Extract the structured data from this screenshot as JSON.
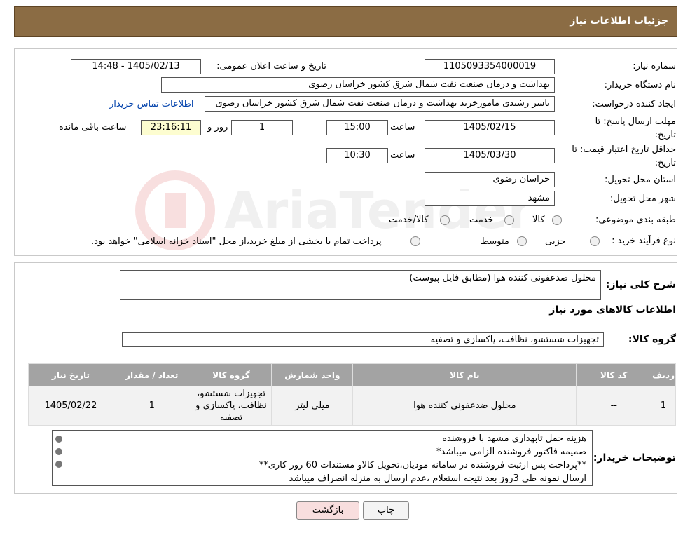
{
  "header": {
    "title": "جزئیات اطلاعات نیاز"
  },
  "fields": {
    "need_number_label": "شماره نیاز:",
    "need_number": "1105093354000019",
    "announce_label": "تاریخ و ساعت اعلان عمومی:",
    "announce_value": "1405/02/13 - 14:48",
    "buyer_org_label": "نام دستگاه خریدار:",
    "buyer_org": "بهداشت و درمان صنعت نفت شمال شرق کشور   خراسان رضوی",
    "creator_label": "ایجاد کننده درخواست:",
    "creator": "یاسر رشیدی مامورخرید بهداشت و درمان صنعت نفت شمال شرق کشور   خراسان رضوی",
    "contact_link": "اطلاعات تماس خریدار",
    "deadline_label_1": "مهلت ارسال پاسخ: تا",
    "deadline_label_2": "تاریخ:",
    "deadline_date": "1405/02/15",
    "time_label": "ساعت",
    "deadline_time": "15:00",
    "days_count": "1",
    "days_label": "روز و",
    "remaining_time": "23:16:11",
    "remaining_label": "ساعت باقی مانده",
    "validity_label_1": "حداقل تاریخ اعتبار قیمت: تا",
    "validity_label_2": "تاریخ:",
    "validity_date": "1405/03/30",
    "validity_time": "10:30",
    "province_label": "استان محل تحویل:",
    "province": "خراسان رضوی",
    "city_label": "شهر محل تحویل:",
    "city": "مشهد",
    "category_label": "طبقه بندی موضوعی:",
    "category_options": [
      "کالا",
      "خدمت",
      "کالا/خدمت"
    ],
    "process_label": "نوع فرآیند خرید :",
    "process_options": [
      "جزیی",
      "متوسط"
    ],
    "process_note": "پرداخت تمام یا بخشی از مبلغ خرید،از محل \"اسناد خزانه اسلامی\" خواهد بود."
  },
  "summary": {
    "desc_label": "شرح کلی نیاز:",
    "desc_value": "محلول ضدعفونی کننده هوا (مطابق فایل پیوست)",
    "goods_info_title": "اطلاعات کالاهای مورد نیاز",
    "goods_group_label": "گروه کالا:",
    "goods_group": "تجهیزات شستشو، نظافت، پاکسازی و تصفیه"
  },
  "table": {
    "headers": [
      "ردیف",
      "کد کالا",
      "نام کالا",
      "واحد شمارش",
      "گروه کالا",
      "تعداد / مقدار",
      "تاریخ نیاز"
    ],
    "rows": [
      [
        "1",
        "--",
        "محلول ضدعفونی کننده هوا",
        "میلی لیتر",
        "تجهیزات شستشو، نظافت، پاکسازی و تصفیه",
        "1",
        "1405/02/22"
      ]
    ]
  },
  "notes": {
    "label": "توضیحات خریدار:",
    "lines": [
      "هزینه حمل تابهداری مشهد با فروشنده",
      "ضمیمه فاکتور فروشنده الزامی میباشد*",
      "**پرداخت پس ازثبت فروشنده در سامانه مودیان،تحویل کالاو مستندات 60 روز کاری**",
      "ارسال نمونه طی 3روز بعد نتیجه استعلام ،عدم ارسال به منزله انصراف میباشد"
    ]
  },
  "buttons": {
    "print": "چاپ",
    "back": "بازگشت"
  },
  "colors": {
    "header_bg": "#8b6c44",
    "table_header_bg": "#a3a3a3",
    "back_button_bg": "#f8dede",
    "remaining_bg": "#fdfdd0"
  }
}
